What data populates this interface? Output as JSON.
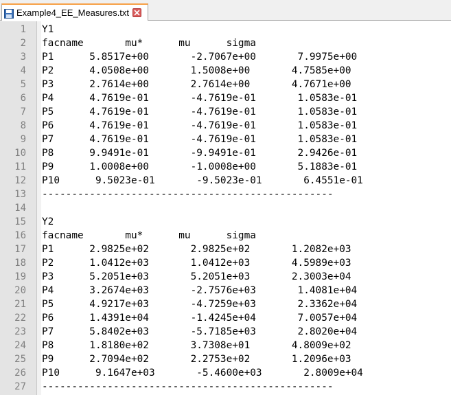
{
  "tab": {
    "title": "Example4_EE_Measures.txt",
    "close_glyph": "✕"
  },
  "editor": {
    "lines": [
      "Y1",
      "facname       mu*      mu      sigma",
      "P1      5.8517e+00       -2.7067e+00       7.9975e+00",
      "P2      4.0508e+00       1.5008e+00       4.7585e+00",
      "P3      2.7614e+00       2.7614e+00       4.7671e+00",
      "P4      4.7619e-01       -4.7619e-01       1.0583e-01",
      "P5      4.7619e-01       -4.7619e-01       1.0583e-01",
      "P6      4.7619e-01       -4.7619e-01       1.0583e-01",
      "P7      4.7619e-01       -4.7619e-01       1.0583e-01",
      "P8      9.9491e-01       -9.9491e-01       2.9426e-01",
      "P9      1.0008e+00       -1.0008e+00       5.1883e-01",
      "P10      9.5023e-01       -9.5023e-01       6.4551e-01",
      "-------------------------------------------------",
      "",
      "Y2",
      "facname       mu*      mu      sigma",
      "P1      2.9825e+02       2.9825e+02       1.2082e+03",
      "P2      1.0412e+03       1.0412e+03       4.5989e+03",
      "P3      5.2051e+03       5.2051e+03       2.3003e+04",
      "P4      3.2674e+03       -2.7576e+03       1.4081e+04",
      "P5      4.9217e+03       -4.7259e+03       2.3362e+04",
      "P6      1.4391e+04       -1.4245e+04       7.0057e+04",
      "P7      5.8402e+03       -5.7185e+03       2.8020e+04",
      "P8      1.8180e+02       3.7308e+01       4.8009e+02",
      "P9      2.7094e+02       2.2753e+02       1.2096e+03",
      "P10      9.1647e+03       -5.4600e+03       2.8009e+04",
      "-------------------------------------------------",
      ""
    ],
    "line_numbers": [
      "1",
      "2",
      "3",
      "4",
      "5",
      "6",
      "7",
      "8",
      "9",
      "10",
      "11",
      "12",
      "13",
      "14",
      "15",
      "16",
      "17",
      "18",
      "19",
      "20",
      "21",
      "22",
      "23",
      "24",
      "25",
      "26",
      "27"
    ]
  },
  "colors": {
    "tab_accent": "#f7a046",
    "gutter_bg": "#e4e4e4",
    "line_number": "#808080",
    "close_button": "#d85a5a"
  },
  "icons": {
    "tab_file": "save-icon",
    "tab_close": "close-icon"
  }
}
